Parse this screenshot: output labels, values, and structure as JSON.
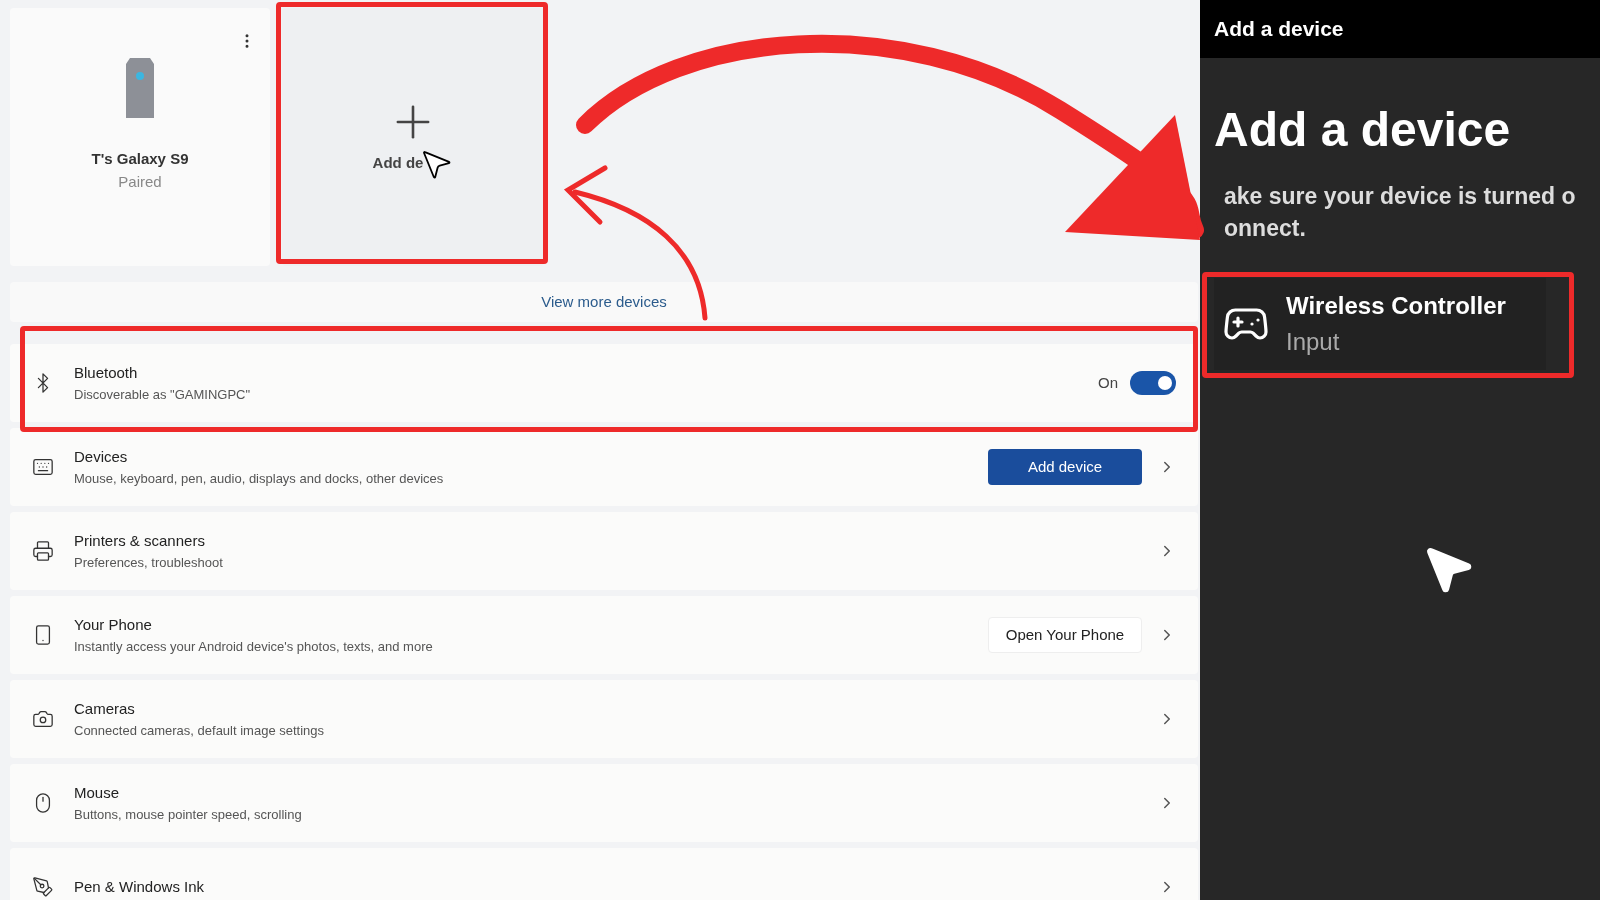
{
  "device_cards": [
    {
      "name": "T's Galaxy S9",
      "status": "Paired"
    }
  ],
  "add_card": {
    "label": "Add de"
  },
  "view_more": "View more devices",
  "settings_rows": [
    {
      "kind": "toggle",
      "title": "Bluetooth",
      "subtitle": "Discoverable as \"GAMINGPC\"",
      "state_label": "On",
      "on": true
    },
    {
      "kind": "button",
      "title": "Devices",
      "subtitle": "Mouse, keyboard, pen, audio, displays and docks, other devices",
      "button": "Add device",
      "primary": true
    },
    {
      "kind": "link",
      "title": "Printers & scanners",
      "subtitle": "Preferences, troubleshoot"
    },
    {
      "kind": "button",
      "title": "Your Phone",
      "subtitle": "Instantly access your Android device's photos, texts, and more",
      "button": "Open Your Phone",
      "primary": false
    },
    {
      "kind": "link",
      "title": "Cameras",
      "subtitle": "Connected cameras, default image settings"
    },
    {
      "kind": "link",
      "title": "Mouse",
      "subtitle": "Buttons, mouse pointer speed, scrolling"
    },
    {
      "kind": "link",
      "title": "Pen & Windows Ink"
    }
  ],
  "dialog": {
    "window_title": "Add a device",
    "heading": "Add a device",
    "instructions": [
      "ake sure your device is turned o",
      "onnect."
    ],
    "found_devices": [
      {
        "name": "Wireless Controller",
        "category": "Input"
      }
    ]
  }
}
